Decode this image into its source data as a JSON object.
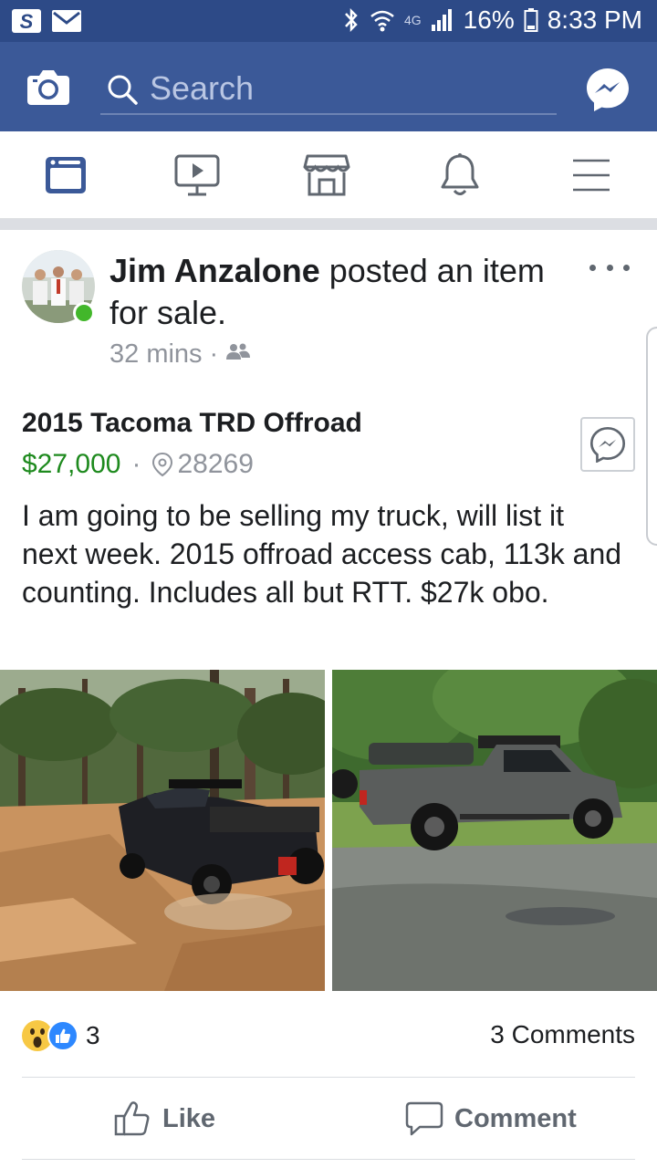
{
  "status_bar": {
    "left_icons": [
      "s-app-icon",
      "gmail-icon"
    ],
    "network": "4G",
    "battery": "16%",
    "time": "8:33 PM"
  },
  "header": {
    "search_placeholder": "Search"
  },
  "nav": {
    "items": [
      "news-feed",
      "watch",
      "marketplace",
      "notifications",
      "menu"
    ],
    "active": "news-feed",
    "accent": "#3b5998"
  },
  "post": {
    "author": "Jim Anzalone",
    "action_text": " posted an item for sale.",
    "time": "32 mins",
    "audience": "friends",
    "item_title": "2015 Tacoma TRD Offroad",
    "price": "$27,000",
    "separator": "·",
    "location": "28269",
    "description": "I am going to be selling my truck, will list it next week.   2015 offroad access cab, 113k and counting.   Includes all but RTT.  $27k obo.",
    "reaction_count": "3",
    "comments_count": "3 Comments",
    "like_label": "Like",
    "comment_label": "Comment",
    "price_color": "#1e8a1e"
  }
}
